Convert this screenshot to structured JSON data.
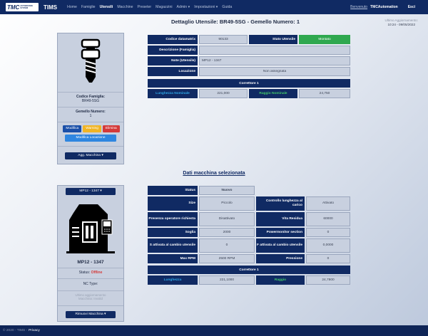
{
  "nav": {
    "logo_mark": "TMC",
    "logo_sub_1": "AUTOMATION",
    "logo_sub_2": "SYSTEM",
    "brand": "TIMS",
    "items": [
      {
        "label": "Home"
      },
      {
        "label": "Famiglie"
      },
      {
        "label": "Utensili"
      },
      {
        "label": "Macchine"
      },
      {
        "label": "Preseter"
      },
      {
        "label": "Magazzini"
      },
      {
        "label": "Admin ▾"
      },
      {
        "label": "Impostazioni ▾"
      },
      {
        "label": "Guida"
      }
    ],
    "active_index": 2,
    "welcome": "Benvenuto",
    "username": "TMCAutomation",
    "logout": "Esci"
  },
  "header": {
    "title": "Dettaglio Utensile: BR49-5SG - Gemello Numero: 1",
    "last_update_label": "Ultimo Aggiornamento:",
    "last_update_value": "10:24 - 09/05/2022"
  },
  "tool_card": {
    "icon": "drill-bit-icon",
    "family_label": "Codice Famiglia:",
    "family_value": "BR49-5SG",
    "twin_label": "Gemello Numero:",
    "twin_value": "1",
    "edit_btn": "Modifica",
    "warning_btn": "Warning",
    "delete_btn": "Elimina",
    "location_btn": "Modifica Locazione",
    "add_machine_btn": "Agg. Macchina ▾"
  },
  "tool_details": {
    "datamatrix_label": "Codice datamatrix",
    "datamatrix_value": "90133",
    "status_label": "Stato Utensile",
    "status_value": "Montato",
    "description_label": "Descrizione (Famiglia)",
    "description_value": "",
    "notes_label": "Note (Utensile)",
    "notes_value": "MP12 - 1347",
    "location_label": "Locazione",
    "location_value": "Non assegnata",
    "corrector_header": "Correttore 1",
    "nominal_length_label": "Lunghezza Nominale",
    "nominal_length_value": "221,000",
    "nominal_radius_label": "Raggio Nominale",
    "nominal_radius_value": "24,750"
  },
  "machine_section_title": "Dati macchina selezionata",
  "machine_card": {
    "select_btn": "MP12 - 1347 ▾",
    "icon": "cnc-machine-icon",
    "name": "MP12 - 1347",
    "status_label": "Status:",
    "status_value": "Offline",
    "nc_type_label": "NC Type:",
    "nc_type_value": "",
    "last_update_1": "Ultimo aggiornamento",
    "last_update_2": "Macchina: Invalid",
    "remove_btn": "Rimuovi Macchina ▾"
  },
  "machine_details": {
    "rows": [
      {
        "label": "Status",
        "value": "Nuovo"
      },
      {
        "label": "Size",
        "value": "Piccolo",
        "label2": "Controllo lunghezza al carico",
        "value2": "Attivato"
      },
      {
        "label": "Presenza operatore richiesta",
        "value": "Disattivato",
        "label2": "Vita Residua",
        "value2": "60000"
      },
      {
        "label": "Soglia",
        "value": "2000",
        "label2": "Powermonitor section",
        "value2": "0"
      },
      {
        "label": "S attivata al cambio utensile",
        "value": "0",
        "label2": "F attivata al cambio utensile",
        "value2": "0,0000"
      },
      {
        "label": "Max RPM",
        "value": "2500 RPM",
        "label2": "Pressione",
        "value2": "0"
      }
    ],
    "corrector_header": "Correttore 1",
    "length_label": "Lunghezza",
    "length_value": "221,1000",
    "radius_label": "Raggio",
    "radius_value": "24,7800"
  },
  "footer": {
    "copyright": "© 2020 - TIMS -",
    "privacy": "Privacy"
  }
}
